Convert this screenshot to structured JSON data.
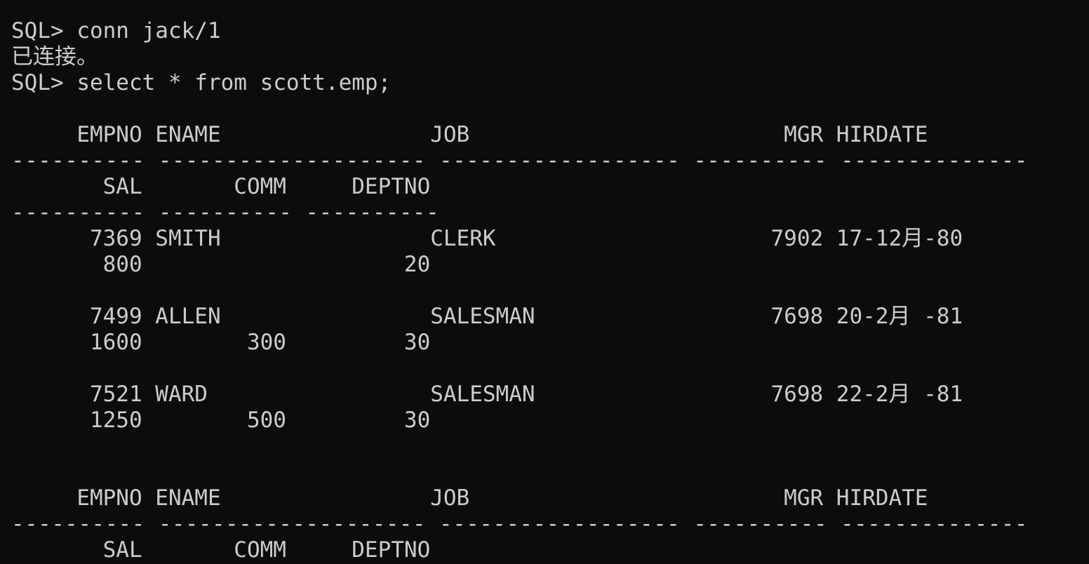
{
  "window": {
    "background": "#0c0c0c",
    "foreground": "#cccccc"
  },
  "terminal": {
    "lines": [
      "SQL> conn jack/1",
      "已连接。",
      "SQL> select * from scott.emp;",
      "",
      "     EMPNO ENAME                JOB                        MGR HIRDATE",
      "---------- -------------------- ------------------ ---------- --------------",
      "       SAL       COMM     DEPTNO",
      "---------- ---------- ----------",
      "      7369 SMITH                CLERK                     7902 17-12月-80",
      "       800                    20",
      "",
      "      7499 ALLEN                SALESMAN                  7698 20-2月 -81",
      "      1600        300         30",
      "",
      "      7521 WARD                 SALESMAN                  7698 22-2月 -81",
      "      1250        500         30",
      "",
      "",
      "     EMPNO ENAME                JOB                        MGR HIRDATE",
      "---------- -------------------- ------------------ ---------- --------------",
      "       SAL       COMM     DEPTNO"
    ]
  }
}
